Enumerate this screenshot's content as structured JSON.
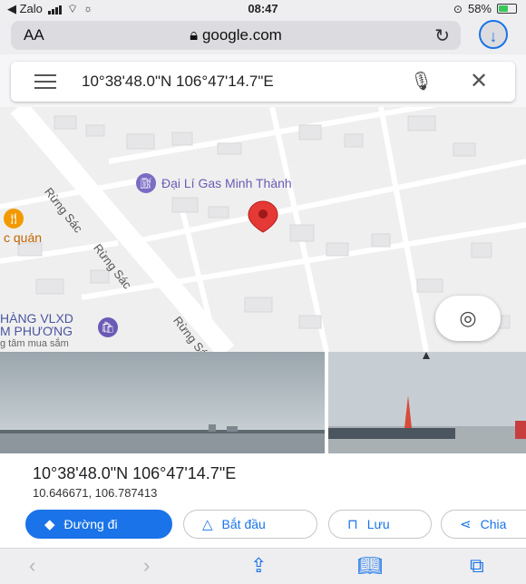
{
  "status": {
    "back_app": "Zalo",
    "time": "08:47",
    "battery": "58%",
    "battery_level": 0.58
  },
  "browser": {
    "aa_label": "AA",
    "domain": "google.com"
  },
  "search": {
    "query": "10°38'48.0\"N 106°47'14.7\"E"
  },
  "map": {
    "labels": {
      "road1": "Rừng Sác",
      "road2": "Rừng Sác",
      "road3": "Rừng Sác",
      "gas_station": "Đại Lí Gas Minh Thành",
      "restaurant": "c quán",
      "store_line1": "HÀNG VLXD",
      "store_line2": "M PHƯƠNG",
      "store_line3": "g tâm mua sắm"
    },
    "pin_color": "#e53935"
  },
  "place": {
    "title": "10°38'48.0\"N 106°47'14.7\"E",
    "decimal": "10.646671, 106.787413"
  },
  "actions": {
    "directions": "Đường đi",
    "start": "Bắt đầu",
    "save": "Lưu",
    "share": "Chia"
  },
  "colors": {
    "accent": "#1a73e8",
    "poi_purple": "#6b5bb5",
    "poi_orange": "#f29900"
  }
}
